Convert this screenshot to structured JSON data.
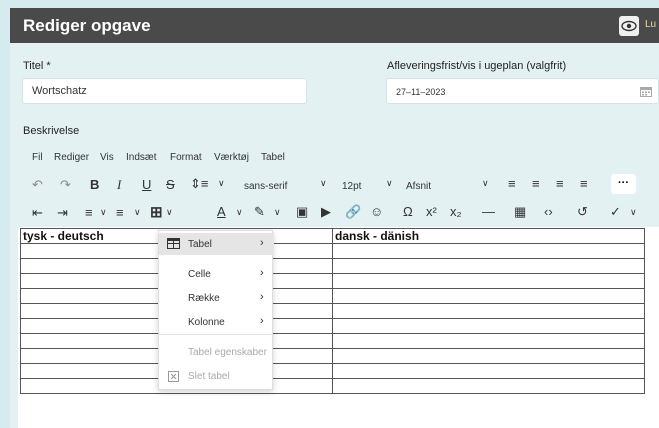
{
  "titlebar": {
    "title": "Rediger opgave",
    "right_text": "Lu"
  },
  "form": {
    "title_label": "Titel *",
    "title_value": "Wortschatz",
    "deadline_label": "Afleveringsfrist/vis i ugeplan (valgfrit)",
    "deadline_value": "27–11–2023",
    "description_label": "Beskrivelse"
  },
  "menu": [
    "Fil",
    "Rediger",
    "Vis",
    "Indsæt",
    "Format",
    "Værktøj",
    "Tabel"
  ],
  "toolbar": {
    "font_family": "sans-serif",
    "font_size": "12pt",
    "block_format": "Afsnit",
    "more": "···"
  },
  "table": {
    "header_left": "tysk - deutsch",
    "header_right": "dansk - dänish",
    "empty_rows": 10
  },
  "dropdown": {
    "items": [
      {
        "label": "Tabel",
        "submenu": true,
        "highlighted": true,
        "icon": "table-icon"
      },
      {
        "label": "Celle",
        "submenu": true
      },
      {
        "label": "Række",
        "submenu": true
      },
      {
        "label": "Kolonne",
        "submenu": true
      },
      {
        "label": "Tabel egenskaber",
        "disabled": true
      },
      {
        "label": "Slet tabel",
        "disabled": true,
        "icon": "delete-table-icon"
      }
    ]
  }
}
